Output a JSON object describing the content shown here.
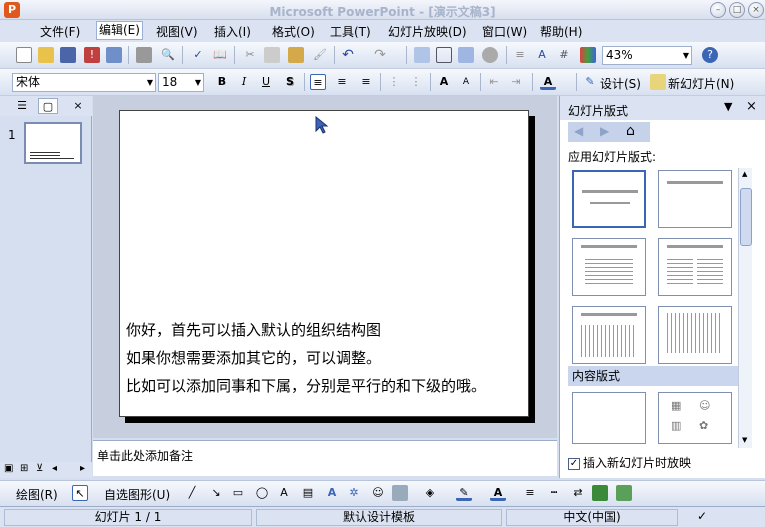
{
  "window": {
    "title": "Microsoft PowerPoint - [演示文稿3]"
  },
  "menubar": {
    "items": [
      {
        "label": "文件(F)"
      },
      {
        "label": "编辑(E)"
      },
      {
        "label": "视图(V)"
      },
      {
        "label": "插入(I)"
      },
      {
        "label": "格式(O)"
      },
      {
        "label": "工具(T)"
      },
      {
        "label": "幻灯片放映(D)"
      },
      {
        "label": "窗口(W)"
      },
      {
        "label": "帮助(H)"
      }
    ]
  },
  "standard_toolbar": {
    "zoom": "43%"
  },
  "format_toolbar": {
    "font_name": "宋体",
    "font_size": "18",
    "bold": "B",
    "italic": "I",
    "underline": "U",
    "shadow": "S",
    "design_label": "设计(S)",
    "new_slide_label": "新幻灯片(N)"
  },
  "slide_panel": {
    "slide_number": "1"
  },
  "slide": {
    "lines": [
      "你好，首先可以插入默认的组织结构图",
      "如果你想需要添加其它的，可以调整。",
      "比如可以添加同事和下属，分别是平行的和下级的哦。"
    ]
  },
  "notes": {
    "placeholder": "单击此处添加备注"
  },
  "task_pane": {
    "title": "幻灯片版式",
    "apply_label": "应用幻灯片版式:",
    "content_section": "内容版式",
    "show_checkbox_label": "插入新幻灯片时放映"
  },
  "drawing_toolbar": {
    "draw_label": "绘图(R)",
    "autoshape_label": "自选图形(U)"
  },
  "statusbar": {
    "slide_info": "幻灯片 1 / 1",
    "design_template": "默认设计模板",
    "language": "中文(中国)"
  },
  "colors": {
    "accent": "#3b66b6",
    "chrome": "#dbe3f2",
    "app_icon": "#e0581c"
  }
}
